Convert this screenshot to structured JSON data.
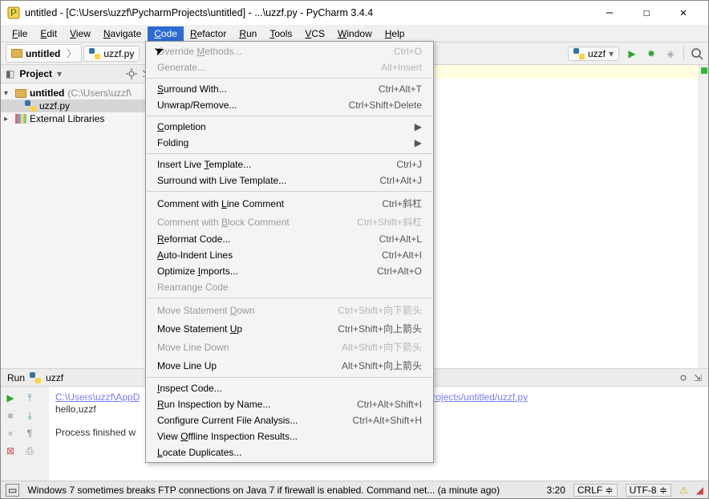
{
  "title": "untitled - [C:\\Users\\uzzf\\PycharmProjects\\untitled] - ...\\uzzf.py - PyCharm 3.4.4",
  "window": {
    "min": "—",
    "max": "☐",
    "close": "✕"
  },
  "menubar": [
    "File",
    "Edit",
    "View",
    "Navigate",
    "Code",
    "Refactor",
    "Run",
    "Tools",
    "VCS",
    "Window",
    "Help"
  ],
  "active_menu_index": 4,
  "breadcrumb": {
    "project": "untitled",
    "file": "uzzf.py"
  },
  "run_config": {
    "name": "uzzf"
  },
  "project_pane": {
    "header": "Project",
    "root": {
      "label": "untitled",
      "path": "(C:\\Users\\uzzf\\"
    },
    "file": "uzzf.py",
    "ext": "External Libraries"
  },
  "code_menu": [
    {
      "label": "Override Methods...",
      "shortcut": "Ctrl+O",
      "disabled": true,
      "u": 9
    },
    {
      "label": "Generate...",
      "shortcut": "Alt+Insert",
      "disabled": true
    },
    {
      "sep": true
    },
    {
      "label": "Surround With...",
      "shortcut": "Ctrl+Alt+T",
      "u": 0
    },
    {
      "label": "Unwrap/Remove...",
      "shortcut": "Ctrl+Shift+Delete"
    },
    {
      "sep": true
    },
    {
      "label": "Completion",
      "sub": true,
      "u": 0
    },
    {
      "label": "Folding",
      "sub": true
    },
    {
      "sep": true
    },
    {
      "label": "Insert Live Template...",
      "shortcut": "Ctrl+J",
      "u": 12
    },
    {
      "label": "Surround with Live Template...",
      "shortcut": "Ctrl+Alt+J"
    },
    {
      "sep": true
    },
    {
      "label": "Comment with Line Comment",
      "shortcut": "Ctrl+斜杠",
      "u": 13
    },
    {
      "label": "Comment with Block Comment",
      "shortcut": "Ctrl+Shift+斜杠",
      "disabled": true,
      "u": 13
    },
    {
      "label": "Reformat Code...",
      "shortcut": "Ctrl+Alt+L",
      "u": 0
    },
    {
      "label": "Auto-Indent Lines",
      "shortcut": "Ctrl+Alt+I",
      "u": 0
    },
    {
      "label": "Optimize Imports...",
      "shortcut": "Ctrl+Alt+O",
      "u": 9
    },
    {
      "label": "Rearrange Code",
      "disabled": true
    },
    {
      "sep": true
    },
    {
      "label": "Move Statement Down",
      "shortcut": "Ctrl+Shift+向下箭头",
      "disabled": true,
      "u": 15
    },
    {
      "label": "Move Statement Up",
      "shortcut": "Ctrl+Shift+向上箭头",
      "u": 15
    },
    {
      "label": "Move Line Down",
      "shortcut": "Alt+Shift+向下箭头",
      "disabled": true
    },
    {
      "label": "Move Line Up",
      "shortcut": "Alt+Shift+向上箭头"
    },
    {
      "sep": true
    },
    {
      "label": "Inspect Code...",
      "u": 0
    },
    {
      "label": "Run Inspection by Name...",
      "shortcut": "Ctrl+Alt+Shift+I",
      "u": 0
    },
    {
      "label": "Configure Current File Analysis...",
      "shortcut": "Ctrl+Alt+Shift+H"
    },
    {
      "label": "View Offline Inspection Results...",
      "u": 5
    },
    {
      "label": "Locate Duplicates...",
      "u": 0
    }
  ],
  "run_panel": {
    "tab": "Run",
    "config": "uzzf",
    "line1a": "C:\\Users\\uzzf\\AppD",
    "line1b": "PycharmProjects/untitled/uzzf.py",
    "line2": "hello,uzzf",
    "line3": "Process finished w"
  },
  "status": {
    "msg": "Windows 7 sometimes breaks FTP connections on Java 7 if firewall is enabled. Command net... (a minute ago)",
    "pos": "3:20",
    "eol": "CRLF",
    "enc": "UTF-8"
  }
}
